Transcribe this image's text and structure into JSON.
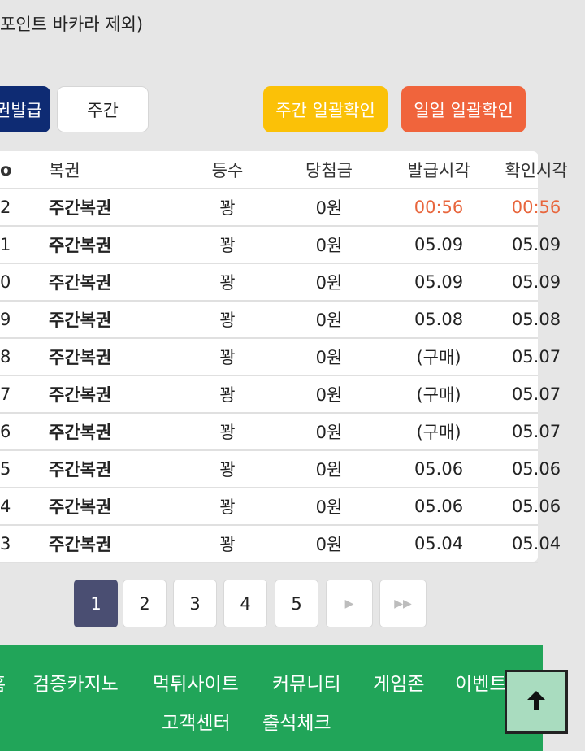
{
  "note": "포인트 바카라 제외)",
  "buttons": {
    "issue": "권발급",
    "weekly": "주간",
    "weekly_check": "주간 일괄확인",
    "daily_check": "일일 일괄확인"
  },
  "table": {
    "headers": [
      "o",
      "복권",
      "등수",
      "당첨금",
      "발급시각",
      "확인시각"
    ],
    "rows": [
      {
        "no": "2",
        "type": "주간복권",
        "rank": "꽝",
        "prize": "0원",
        "issued": "00:56",
        "checked": "00:56",
        "highlight": true
      },
      {
        "no": "1",
        "type": "주간복권",
        "rank": "꽝",
        "prize": "0원",
        "issued": "05.09",
        "checked": "05.09",
        "highlight": false
      },
      {
        "no": "0",
        "type": "주간복권",
        "rank": "꽝",
        "prize": "0원",
        "issued": "05.09",
        "checked": "05.09",
        "highlight": false
      },
      {
        "no": "9",
        "type": "주간복권",
        "rank": "꽝",
        "prize": "0원",
        "issued": "05.08",
        "checked": "05.08",
        "highlight": false
      },
      {
        "no": "8",
        "type": "주간복권",
        "rank": "꽝",
        "prize": "0원",
        "issued": "(구매)",
        "checked": "05.07",
        "highlight": false
      },
      {
        "no": "7",
        "type": "주간복권",
        "rank": "꽝",
        "prize": "0원",
        "issued": "(구매)",
        "checked": "05.07",
        "highlight": false
      },
      {
        "no": "6",
        "type": "주간복권",
        "rank": "꽝",
        "prize": "0원",
        "issued": "(구매)",
        "checked": "05.07",
        "highlight": false
      },
      {
        "no": "5",
        "type": "주간복권",
        "rank": "꽝",
        "prize": "0원",
        "issued": "05.06",
        "checked": "05.06",
        "highlight": false
      },
      {
        "no": "4",
        "type": "주간복권",
        "rank": "꽝",
        "prize": "0원",
        "issued": "05.06",
        "checked": "05.06",
        "highlight": false
      },
      {
        "no": "3",
        "type": "주간복권",
        "rank": "꽝",
        "prize": "0원",
        "issued": "05.04",
        "checked": "05.04",
        "highlight": false
      }
    ]
  },
  "pagination": {
    "pages": [
      "1",
      "2",
      "3",
      "4",
      "5"
    ],
    "active": 0,
    "next_icon": "next-icon",
    "last_icon": "last-icon"
  },
  "footer": {
    "nav": [
      "홈",
      "검증카지노",
      "먹튀사이트",
      "커뮤니티",
      "게임존",
      "이벤트",
      "고객센터",
      "출석체크"
    ]
  },
  "scroll_top_icon": "arrow-up-icon",
  "colors": {
    "issue_button": "#0e2b73",
    "weekly_check_button": "#fbc107",
    "daily_check_button": "#f0643c",
    "highlight_time": "#e8663d",
    "active_page": "#4a4e72",
    "footer_bg": "#21a559"
  }
}
